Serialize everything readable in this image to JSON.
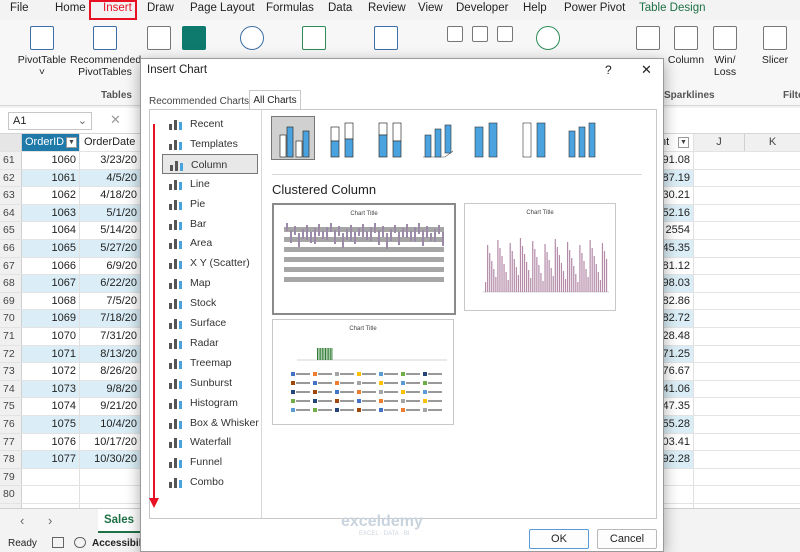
{
  "menubar": {
    "items": [
      "File",
      "Home",
      "Insert",
      "Draw",
      "Page Layout",
      "Formulas",
      "Data",
      "Review",
      "View",
      "Developer",
      "Help",
      "Power Pivot",
      "Table Design"
    ],
    "active": "Insert",
    "accent_color": "#1e7145",
    "highlight_color": "#e81123"
  },
  "ribbon": {
    "pivottable": "PivotTable",
    "recommended_pivottables": "Recommended PivotTables",
    "tables_group": "Tables",
    "column": "Column",
    "winloss": "Win/ Loss",
    "sparklines_group": "Sparklines",
    "slicer": "Slicer",
    "filter_group_partial": "Filte"
  },
  "formula_bar": {
    "name_box": "A1"
  },
  "sheet": {
    "headers": {
      "col_a": "OrderID",
      "col_b": "OrderDate",
      "col_j": "J",
      "col_k": "K",
      "col_partial": "nt"
    },
    "rows": [
      {
        "n": "61",
        "id": "1060",
        "date": "3/23/20",
        "amt": "91.08"
      },
      {
        "n": "62",
        "id": "1061",
        "date": "4/5/20",
        "amt": "87.19"
      },
      {
        "n": "63",
        "id": "1062",
        "date": "4/18/20",
        "amt": "30.21"
      },
      {
        "n": "64",
        "id": "1063",
        "date": "5/1/20",
        "amt": "52.16"
      },
      {
        "n": "65",
        "id": "1064",
        "date": "5/14/20",
        "amt": "2554"
      },
      {
        "n": "66",
        "id": "1065",
        "date": "5/27/20",
        "amt": "45.35"
      },
      {
        "n": "67",
        "id": "1066",
        "date": "6/9/20",
        "amt": "81.12"
      },
      {
        "n": "68",
        "id": "1067",
        "date": "6/22/20",
        "amt": "98.03"
      },
      {
        "n": "69",
        "id": "1068",
        "date": "7/5/20",
        "amt": "82.86"
      },
      {
        "n": "70",
        "id": "1069",
        "date": "7/18/20",
        "amt": "82.72"
      },
      {
        "n": "71",
        "id": "1070",
        "date": "7/31/20",
        "amt": "28.48"
      },
      {
        "n": "72",
        "id": "1071",
        "date": "8/13/20",
        "amt": "71.25"
      },
      {
        "n": "73",
        "id": "1072",
        "date": "8/26/20",
        "amt": "76.67"
      },
      {
        "n": "74",
        "id": "1073",
        "date": "9/8/20",
        "amt": "41.06"
      },
      {
        "n": "75",
        "id": "1074",
        "date": "9/21/20",
        "amt": "47.35"
      },
      {
        "n": "76",
        "id": "1075",
        "date": "10/4/20",
        "amt": "55.28"
      },
      {
        "n": "77",
        "id": "1076",
        "date": "10/17/20",
        "amt": "03.41"
      },
      {
        "n": "78",
        "id": "1077",
        "date": "10/30/20",
        "amt": "92.28"
      },
      {
        "n": "79",
        "id": "",
        "date": "",
        "amt": ""
      },
      {
        "n": "80",
        "id": "",
        "date": "",
        "amt": ""
      },
      {
        "n": "81",
        "id": "",
        "date": "",
        "amt": ""
      }
    ]
  },
  "sheet_tabs": {
    "active": "Sales"
  },
  "status": {
    "ready": "Ready",
    "accessibility": "Accessibilit"
  },
  "dialog": {
    "title": "Insert Chart",
    "help": "?",
    "close": "✕",
    "tabs": [
      "Recommended Charts",
      "All Charts"
    ],
    "active_tab": "All Charts",
    "nav": [
      {
        "label": "Recent",
        "icon": "recent-icon"
      },
      {
        "label": "Templates",
        "icon": "templates-icon"
      },
      {
        "label": "Column",
        "icon": "column-chart-icon"
      },
      {
        "label": "Line",
        "icon": "line-chart-icon"
      },
      {
        "label": "Pie",
        "icon": "pie-chart-icon"
      },
      {
        "label": "Bar",
        "icon": "bar-chart-icon"
      },
      {
        "label": "Area",
        "icon": "area-chart-icon"
      },
      {
        "label": "X Y (Scatter)",
        "icon": "scatter-chart-icon"
      },
      {
        "label": "Map",
        "icon": "map-chart-icon"
      },
      {
        "label": "Stock",
        "icon": "stock-chart-icon"
      },
      {
        "label": "Surface",
        "icon": "surface-chart-icon"
      },
      {
        "label": "Radar",
        "icon": "radar-chart-icon"
      },
      {
        "label": "Treemap",
        "icon": "treemap-chart-icon"
      },
      {
        "label": "Sunburst",
        "icon": "sunburst-chart-icon"
      },
      {
        "label": "Histogram",
        "icon": "histogram-chart-icon"
      },
      {
        "label": "Box & Whisker",
        "icon": "box-whisker-chart-icon"
      },
      {
        "label": "Waterfall",
        "icon": "waterfall-chart-icon"
      },
      {
        "label": "Funnel",
        "icon": "funnel-chart-icon"
      },
      {
        "label": "Combo",
        "icon": "combo-chart-icon"
      }
    ],
    "selected_nav": "Column",
    "subtype_heading": "Clustered Column",
    "preview_title": "Chart Title",
    "ok": "OK",
    "cancel": "Cancel"
  },
  "watermark": {
    "brand": "exceldemy",
    "tagline": "EXCEL · DATA · BI"
  }
}
